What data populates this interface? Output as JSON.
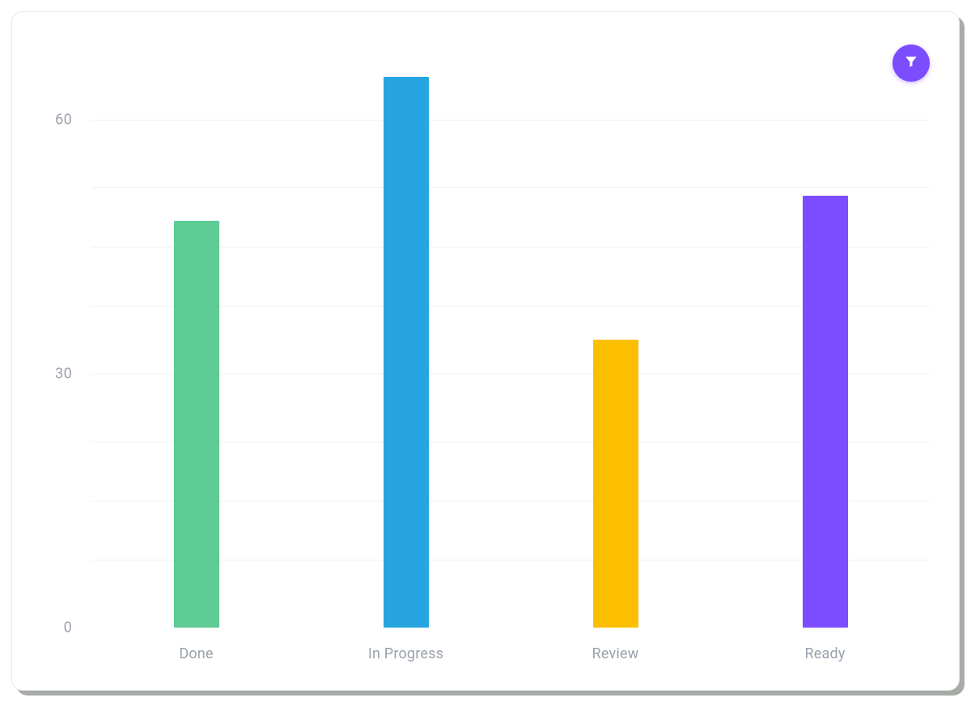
{
  "filter_button": {
    "icon": "filter-icon"
  },
  "chart_data": {
    "type": "bar",
    "categories": [
      "Done",
      "In Progress",
      "Review",
      "Ready"
    ],
    "values": [
      48,
      65,
      34,
      51
    ],
    "title": "",
    "xlabel": "",
    "ylabel": "",
    "ylim": [
      0,
      70
    ],
    "yticks": [
      0,
      30,
      60
    ],
    "colors": [
      "#5ecb95",
      "#27a5e0",
      "#fbbf00",
      "#7c4dff"
    ]
  }
}
